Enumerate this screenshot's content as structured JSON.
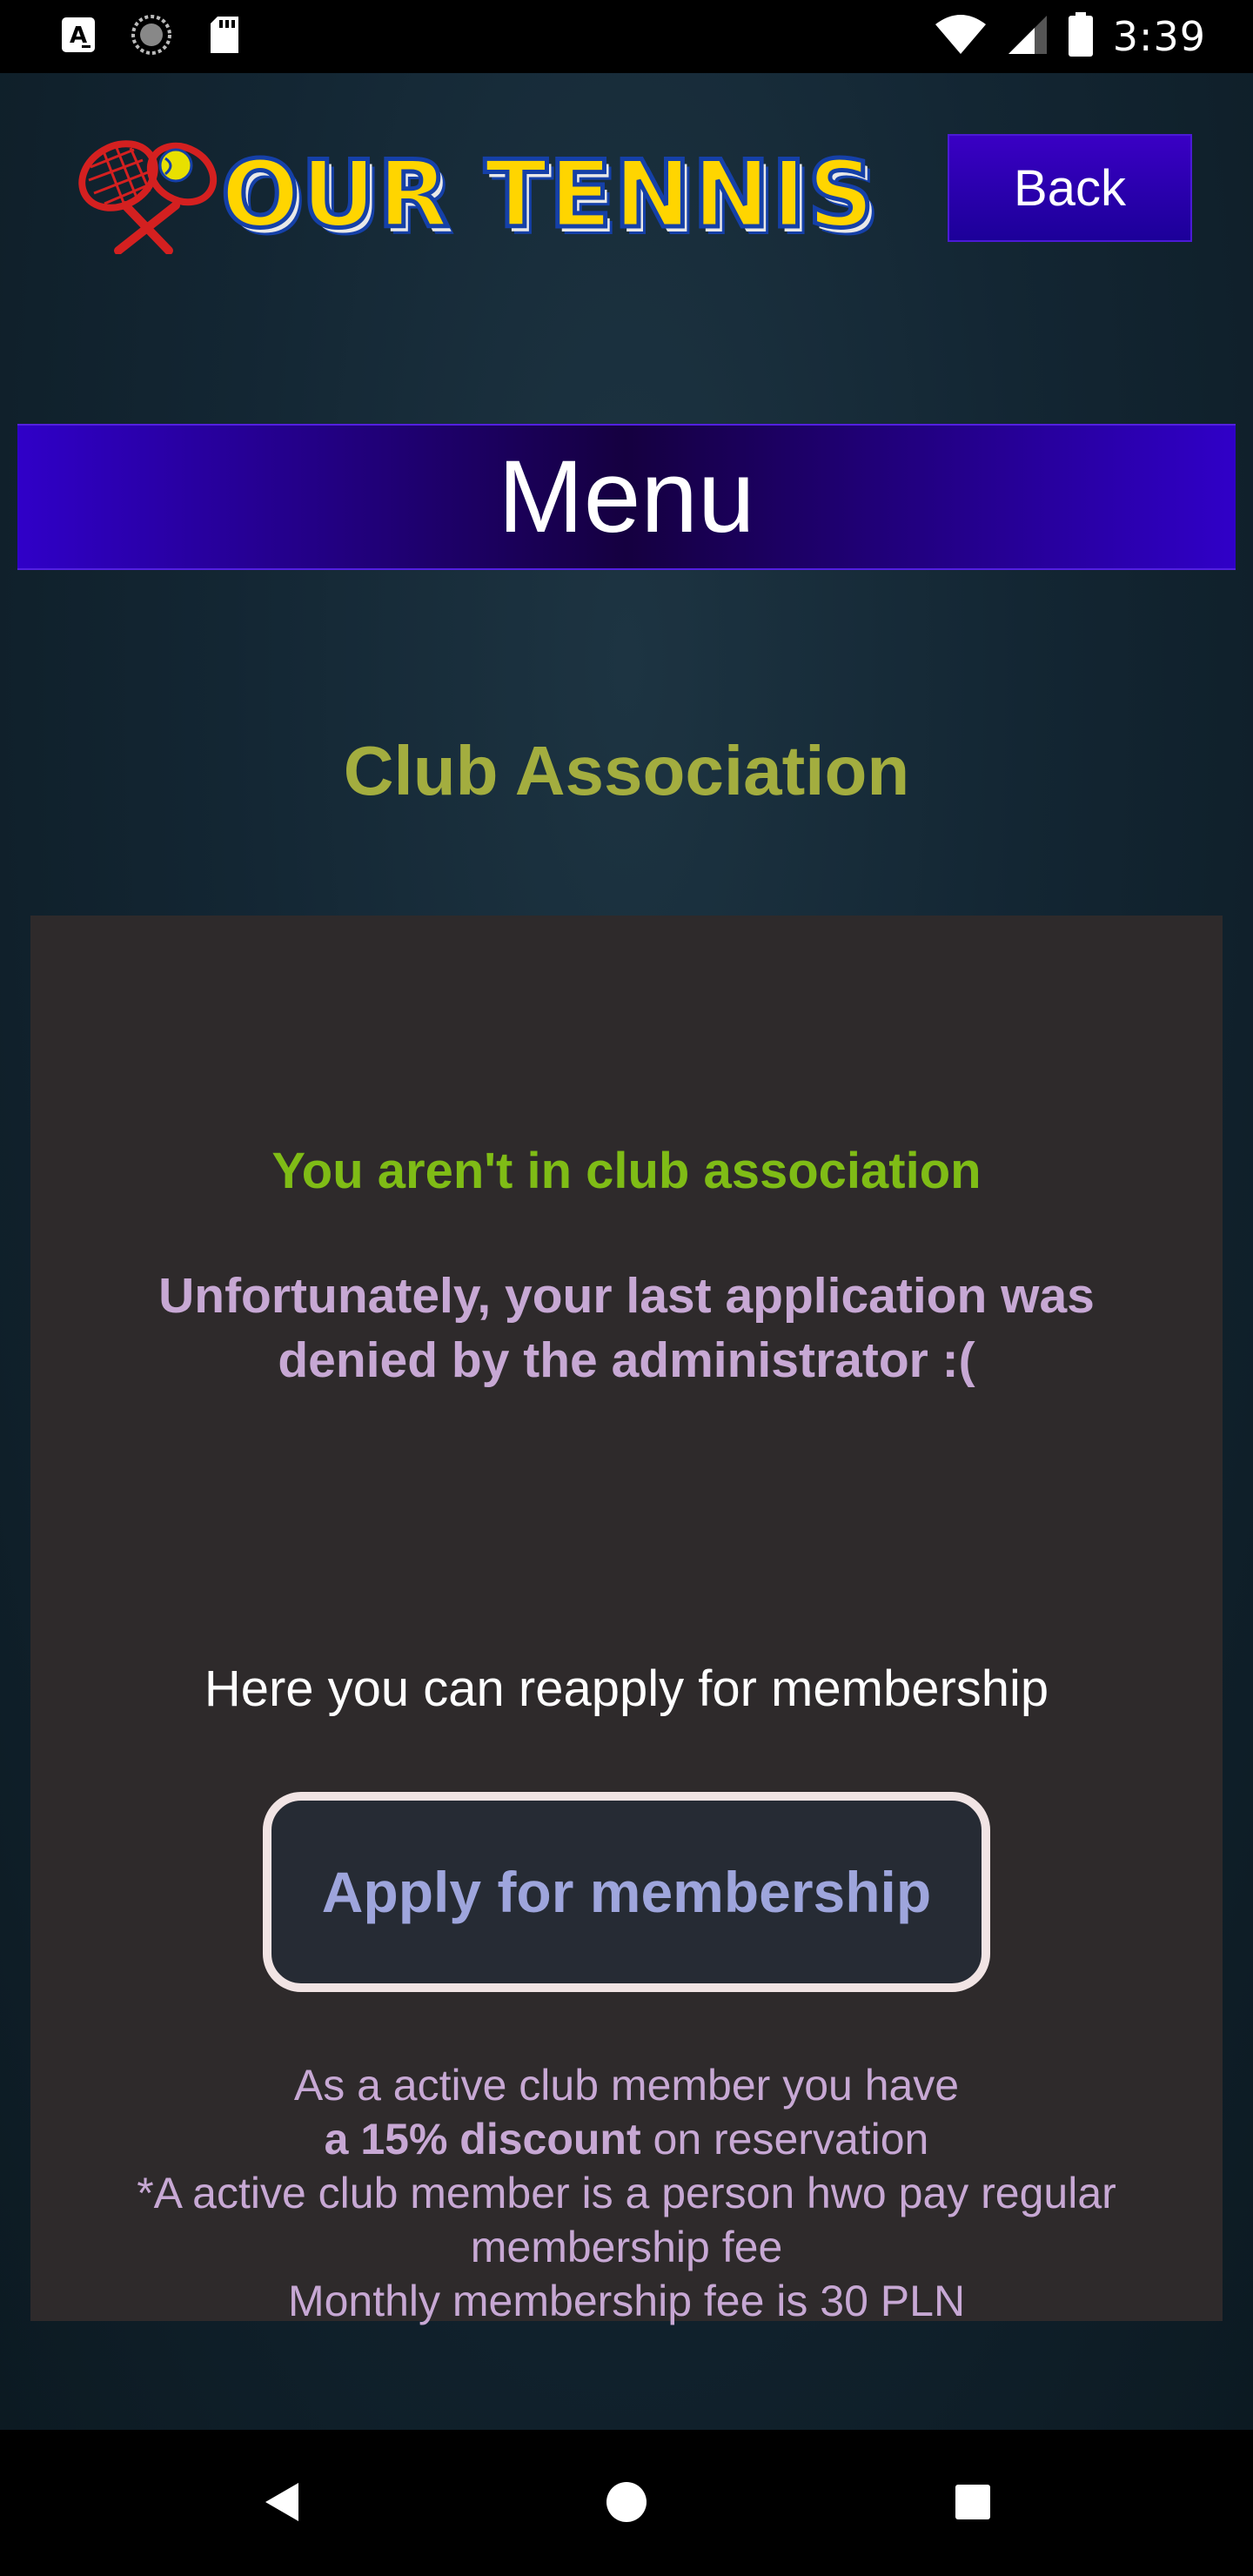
{
  "status_bar": {
    "clock": "3:39",
    "icons": [
      "a-notification-icon",
      "sync-icon",
      "sd-card-icon",
      "wifi-icon",
      "signal-icon",
      "battery-icon"
    ]
  },
  "header": {
    "logo_text": "OUR TENNIS",
    "back_label": "Back"
  },
  "menu": {
    "label": "Menu"
  },
  "main": {
    "title": "Club Association",
    "status_message": "You aren't in club association",
    "denied_message": "Unfortunately, your last application was denied by the administrator :(",
    "reapply_message": "Here you can reapply for membership",
    "apply_button_label": "Apply for membership",
    "info": {
      "line1": "As a active club member you have",
      "discount_bold": "a 15% discount",
      "discount_rest": " on reservation",
      "line3": "*A active club member is a person hwo pay regular membership fee",
      "line4": "Monthly membership fee is 30 PLN"
    }
  },
  "nav_bar": {
    "icons": [
      "back-triangle-icon",
      "home-circle-icon",
      "recents-square-icon"
    ]
  },
  "colors": {
    "accent_purple": "#2a00c0",
    "title_olive": "#a3ad3f",
    "status_green": "#7fbc16",
    "text_lavender": "#c7a8d4",
    "button_text": "#9ea5dc",
    "card_bg": "#2e2a2b"
  }
}
